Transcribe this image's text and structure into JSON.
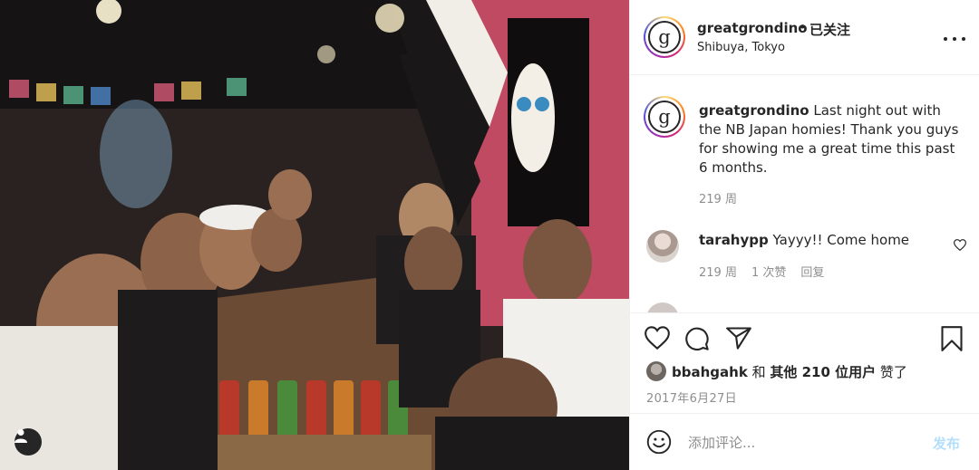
{
  "post": {
    "username": "greatgrondino",
    "separator": "•",
    "follow_status": "已关注",
    "location": "Shibuya, Tokyo",
    "avatar_letter": "g"
  },
  "caption": {
    "username": "greatgrondino",
    "text": "Last night out with the NB Japan homies! Thank you guys for showing me a great time this past 6 months.",
    "time": "219 周"
  },
  "comments": [
    {
      "username": "tarahypp",
      "text": "Yayyy!! Come home",
      "time": "219 周",
      "likes": "1 次赞",
      "reply": "回复"
    }
  ],
  "next_comment_partial": "",
  "actions": {
    "icons": [
      "heart-icon",
      "comment-icon",
      "share-icon",
      "bookmark-icon"
    ]
  },
  "likes": {
    "user": "bbahgahk",
    "and": "和",
    "others": "其他 210 位用户",
    "suffix": "赞了"
  },
  "date": "2017年6月27日",
  "add_comment": {
    "placeholder": "添加评论...",
    "post_label": "发布"
  },
  "colors": {
    "text": "#262626",
    "secondary": "#8e8e8e",
    "border": "#efefef",
    "post_disabled": "#b2dffc"
  }
}
